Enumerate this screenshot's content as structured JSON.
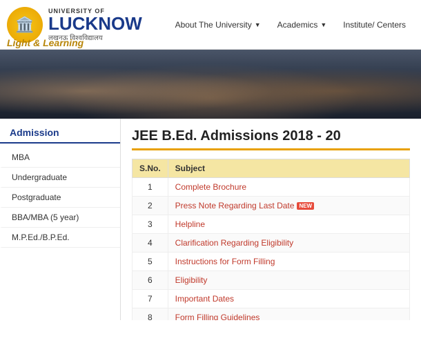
{
  "header": {
    "logo_emoji": "🏛️",
    "univ_of": "UNIVERSITY OF",
    "lucknow": "LUCKNOW",
    "hindi": "लखनऊ विश्वविद्यालय",
    "tagline": "Light & Learning"
  },
  "nav": {
    "items": [
      {
        "label": "About The University",
        "has_dropdown": true
      },
      {
        "label": "Academics",
        "has_dropdown": true
      },
      {
        "label": "Institute/ Centers",
        "has_dropdown": false
      }
    ]
  },
  "sidebar": {
    "title": "Admission",
    "items": [
      {
        "label": "MBA"
      },
      {
        "label": "Undergraduate"
      },
      {
        "label": "Postgraduate"
      },
      {
        "label": "BBA/MBA (5 year)"
      },
      {
        "label": "M.P.Ed./B.P.Ed."
      }
    ]
  },
  "content": {
    "title": "JEE B.Ed. Admissions 2018 - 20",
    "table": {
      "headers": [
        "S.No.",
        "Subject"
      ],
      "rows": [
        {
          "sno": "1",
          "subject": "Complete Brochure",
          "is_link": true,
          "is_new": false
        },
        {
          "sno": "2",
          "subject": "Press Note Regarding Last Date",
          "is_link": true,
          "is_new": true
        },
        {
          "sno": "3",
          "subject": "Helpline",
          "is_link": true,
          "is_new": false
        },
        {
          "sno": "4",
          "subject": "Clarification Regarding Eligibility",
          "is_link": true,
          "is_new": false
        },
        {
          "sno": "5",
          "subject": "Instructions for Form Filling",
          "is_link": true,
          "is_new": false
        },
        {
          "sno": "6",
          "subject": "Eligibility",
          "is_link": true,
          "is_new": false
        },
        {
          "sno": "7",
          "subject": "Important Dates",
          "is_link": true,
          "is_new": false
        },
        {
          "sno": "8",
          "subject": "Form Filling Guidelines",
          "is_link": true,
          "is_new": false
        }
      ]
    }
  }
}
